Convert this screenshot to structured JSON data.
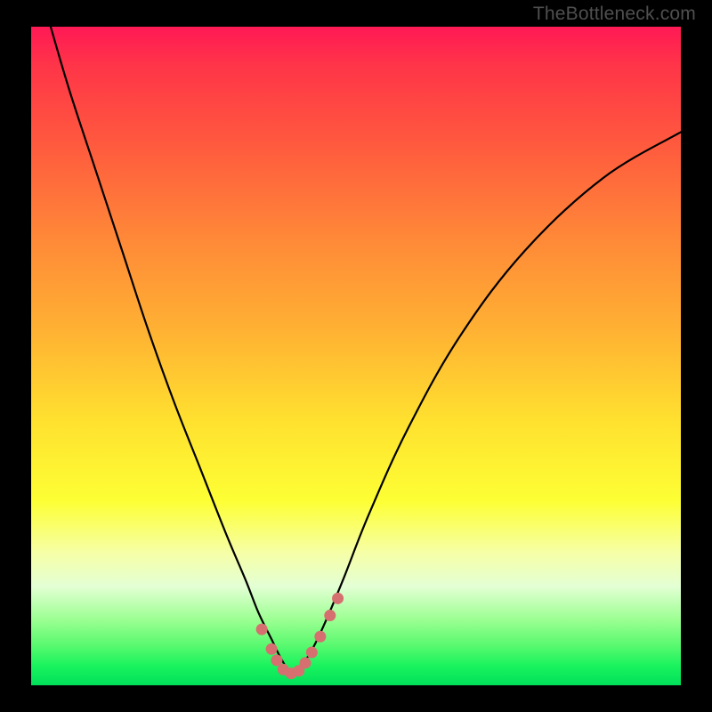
{
  "watermark": "TheBottleneck.com",
  "chart_data": {
    "type": "line",
    "title": "",
    "xlabel": "",
    "ylabel": "",
    "xlim": [
      0,
      100
    ],
    "ylim": [
      0,
      100
    ],
    "grid": false,
    "legend": false,
    "background_gradient": [
      "#ff1955",
      "#ff8838",
      "#ffe12f",
      "#f6ffa8",
      "#00e05a"
    ],
    "series": [
      {
        "name": "curve",
        "color": "#000000",
        "x": [
          3,
          6,
          10,
          14,
          18,
          22,
          26,
          30,
          33,
          35,
          37,
          38.5,
          40,
          41.5,
          43,
          45,
          48,
          52,
          58,
          66,
          76,
          88,
          100
        ],
        "values": [
          100,
          90,
          78,
          66,
          54,
          43,
          33,
          23,
          16,
          11,
          7,
          4,
          2,
          3,
          5,
          9,
          16,
          26,
          39,
          53,
          66,
          77,
          84
        ]
      }
    ],
    "markers": {
      "name": "dots",
      "color": "#d66f6f",
      "x": [
        35.5,
        37.0,
        37.8,
        38.8,
        40.0,
        41.2,
        42.2,
        43.2,
        44.5,
        46.0,
        47.2
      ],
      "values": [
        8.5,
        5.5,
        3.8,
        2.4,
        1.8,
        2.2,
        3.4,
        5.0,
        7.4,
        10.6,
        13.2
      ]
    }
  }
}
